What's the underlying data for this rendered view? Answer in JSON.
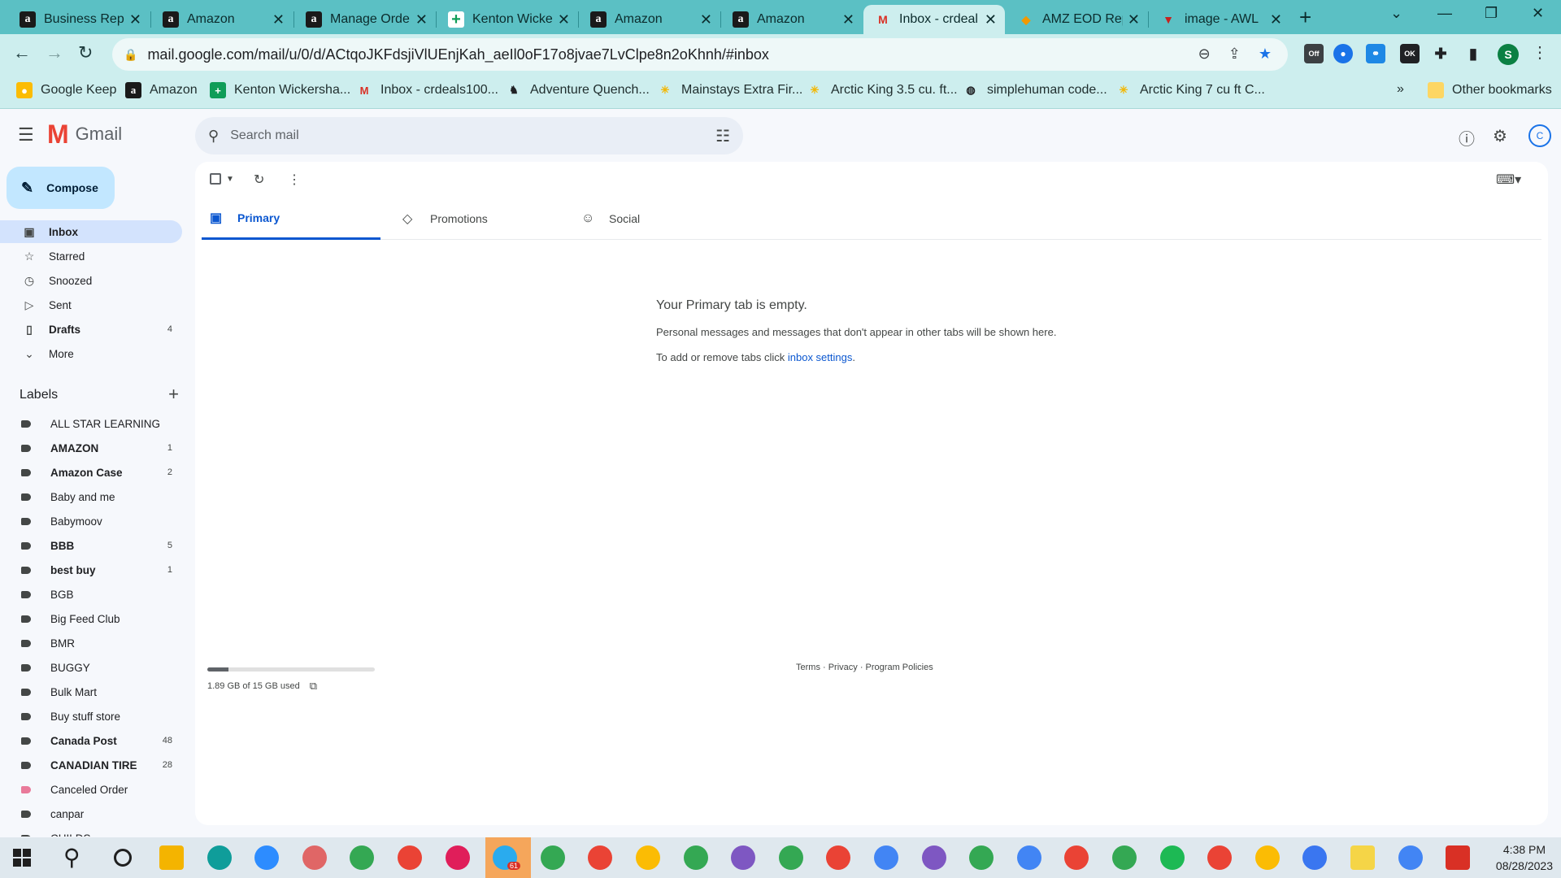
{
  "browser": {
    "tabs": [
      {
        "title": "Business Repo",
        "icon": "amazon-favicon"
      },
      {
        "title": "Amazon",
        "icon": "amazon-favicon"
      },
      {
        "title": "Manage Orde",
        "icon": "amazon-favicon"
      },
      {
        "title": "Kenton Wicke",
        "icon": "sheets-favicon"
      },
      {
        "title": "Amazon",
        "icon": "amazon-favicon"
      },
      {
        "title": "Amazon",
        "icon": "amazon-favicon"
      },
      {
        "title": "Inbox - crdeal",
        "icon": "gmail-favicon",
        "active": true
      },
      {
        "title": "AMZ EOD Rep",
        "icon": "amz-eod-favicon"
      },
      {
        "title": "image - AWL",
        "icon": "awl-favicon"
      }
    ],
    "url": "mail.google.com/mail/u/0/d/ACtqoJKFdsjiVlUEnjKah_aeIl0oF17o8jvae7LvClpe8n2oKhnh/#inbox",
    "profile_initial": "S",
    "ext_off_label": "Off",
    "ext_ok_label": "OK",
    "bookmarks": [
      {
        "label": "Google Keep",
        "icon": "keep-icon"
      },
      {
        "label": "Amazon",
        "icon": "amazon-icon"
      },
      {
        "label": "Kenton Wickersha...",
        "icon": "sheets-icon"
      },
      {
        "label": "Inbox - crdeals100...",
        "icon": "gmail-icon"
      },
      {
        "label": "Adventure Quench...",
        "icon": "adventure-icon"
      },
      {
        "label": "Mainstays Extra Fir...",
        "icon": "walmart-icon"
      },
      {
        "label": "Arctic King 3.5 cu. ft...",
        "icon": "walmart-icon"
      },
      {
        "label": "simplehuman code...",
        "icon": "globe-icon"
      },
      {
        "label": "Arctic King 7 cu ft C...",
        "icon": "walmart-icon"
      }
    ],
    "bookmarks_overflow": "»",
    "other_bookmarks": "Other bookmarks"
  },
  "gmail": {
    "brand": "Gmail",
    "search_placeholder": "Search mail",
    "compose_label": "Compose",
    "nav": [
      {
        "label": "Inbox",
        "count": "",
        "active": true,
        "bold": true
      },
      {
        "label": "Starred",
        "count": ""
      },
      {
        "label": "Snoozed",
        "count": ""
      },
      {
        "label": "Sent",
        "count": ""
      },
      {
        "label": "Drafts",
        "count": "4",
        "bold": true
      },
      {
        "label": "More",
        "count": ""
      }
    ],
    "labels_heading": "Labels",
    "labels": [
      {
        "label": "ALL STAR LEARNING",
        "count": ""
      },
      {
        "label": "AMAZON",
        "count": "1",
        "bold": true
      },
      {
        "label": "Amazon Case",
        "count": "2",
        "bold": true
      },
      {
        "label": "Baby and me",
        "count": ""
      },
      {
        "label": "Babymoov",
        "count": ""
      },
      {
        "label": "BBB",
        "count": "5",
        "bold": true
      },
      {
        "label": "best buy",
        "count": "1",
        "bold": true
      },
      {
        "label": "BGB",
        "count": ""
      },
      {
        "label": "Big Feed Club",
        "count": ""
      },
      {
        "label": "BMR",
        "count": ""
      },
      {
        "label": "BUGGY",
        "count": ""
      },
      {
        "label": "Bulk Mart",
        "count": ""
      },
      {
        "label": "Buy stuff store",
        "count": ""
      },
      {
        "label": "Canada Post",
        "count": "48",
        "bold": true
      },
      {
        "label": "CANADIAN TIRE",
        "count": "28",
        "bold": true
      },
      {
        "label": "Canceled Order",
        "count": "",
        "color": "#e97a9a"
      },
      {
        "label": "canpar",
        "count": ""
      },
      {
        "label": "CHILDS",
        "count": ""
      }
    ],
    "tabs": [
      {
        "label": "Primary",
        "active": true
      },
      {
        "label": "Promotions"
      },
      {
        "label": "Social"
      }
    ],
    "empty_title": "Your Primary tab is empty.",
    "empty_desc": "Personal messages and messages that don't appear in other tabs will be shown here.",
    "empty_settings_prefix": "To add or remove tabs click ",
    "empty_settings_link": "inbox settings",
    "empty_settings_suffix": ".",
    "storage_text": "1.89 GB of 15 GB used",
    "storage_fraction": 0.126,
    "footer": "Terms · Privacy · Program Policies"
  },
  "taskbar": {
    "time": "4:38 PM",
    "date": "08/28/2023",
    "telegram_badge": "61"
  }
}
